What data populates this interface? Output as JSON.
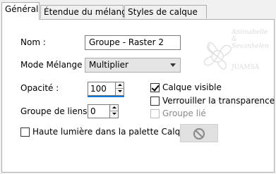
{
  "tabs": [
    {
      "label": "Général",
      "active": true
    },
    {
      "label": "Étendue du mélange",
      "active": false
    },
    {
      "label": "Styles de calque",
      "active": false
    }
  ],
  "form": {
    "name_label": "Nom :",
    "name_value": "Groupe - Raster 2",
    "blend_label": "Mode Mélange :",
    "blend_value": "Multiplier",
    "opacity_label": "Opacité :",
    "opacity_value": "100",
    "group_label": "Groupe de liens :",
    "group_value": "0",
    "visible_label": "Calque visible",
    "visible_checked": true,
    "lock_label": "Verrouiller la transparence",
    "lock_checked": false,
    "grouplinked_label": "Groupe lié",
    "grouplinked_checked": false,
    "grouplinked_enabled": false,
    "highlight_label": "Haute lumière dans la palette Calques :",
    "highlight_checked": false
  },
  "watermark": {
    "text": "Animabelle & Sevanhelen",
    "logo_text": "JUAMSA"
  },
  "icons": {
    "highlight_color": "no-symbol-icon"
  }
}
